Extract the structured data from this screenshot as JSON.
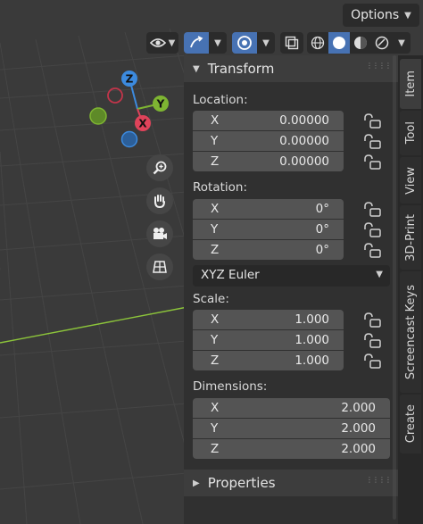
{
  "header": {
    "options_label": "Options",
    "options_dropdown_icon": "chevron-down-icon"
  },
  "toolbar": {
    "items": [
      {
        "icon": "visibility-eye-icon",
        "active": false
      },
      {
        "icon": "gizmo-toggle-icon",
        "active": true
      },
      {
        "icon": "overlays-icon",
        "active": true
      },
      {
        "icon": "xray-toggle-icon",
        "active": false
      },
      {
        "icon": "shading-wireframe-icon",
        "active": false
      },
      {
        "icon": "shading-solid-icon",
        "active": true
      },
      {
        "icon": "shading-material-icon",
        "active": false
      },
      {
        "icon": "shading-rendered-icon",
        "active": false
      }
    ]
  },
  "gizmo": {
    "x_label": "X",
    "y_label": "Y",
    "z_label": "Z",
    "colors": {
      "x": "#e0435a",
      "y": "#7eb532",
      "z": "#3c8ade",
      "x_neg": "#8e2c3a",
      "y_neg": "#5e8a28",
      "z_neg": "#2c5f99"
    }
  },
  "nav_tools": [
    "zoom-icon",
    "pan-hand-icon",
    "camera-view-icon",
    "ortho-grid-icon"
  ],
  "transform": {
    "header": "Transform",
    "location": {
      "label": "Location:",
      "rows": [
        {
          "axis": "X",
          "value": "0.00000"
        },
        {
          "axis": "Y",
          "value": "0.00000"
        },
        {
          "axis": "Z",
          "value": "0.00000"
        }
      ]
    },
    "rotation": {
      "label": "Rotation:",
      "rows": [
        {
          "axis": "X",
          "value": "0°"
        },
        {
          "axis": "Y",
          "value": "0°"
        },
        {
          "axis": "Z",
          "value": "0°"
        }
      ],
      "mode": "XYZ Euler"
    },
    "scale": {
      "label": "Scale:",
      "rows": [
        {
          "axis": "X",
          "value": "1.000"
        },
        {
          "axis": "Y",
          "value": "1.000"
        },
        {
          "axis": "Z",
          "value": "1.000"
        }
      ]
    },
    "dimensions": {
      "label": "Dimensions:",
      "rows": [
        {
          "axis": "X",
          "value": "2.000"
        },
        {
          "axis": "Y",
          "value": "2.000"
        },
        {
          "axis": "Z",
          "value": "2.000"
        }
      ]
    }
  },
  "properties_header": "Properties",
  "tabs": [
    {
      "label": "Item",
      "active": true
    },
    {
      "label": "Tool",
      "active": false
    },
    {
      "label": "View",
      "active": false
    },
    {
      "label": "3D-Print",
      "active": false
    },
    {
      "label": "Screencast Keys",
      "active": false
    },
    {
      "label": "Create",
      "active": false
    }
  ],
  "colors": {
    "accent": "#4772b3",
    "grid_line": "#4a4a4a",
    "axis_x_line": "#8cc43a"
  }
}
